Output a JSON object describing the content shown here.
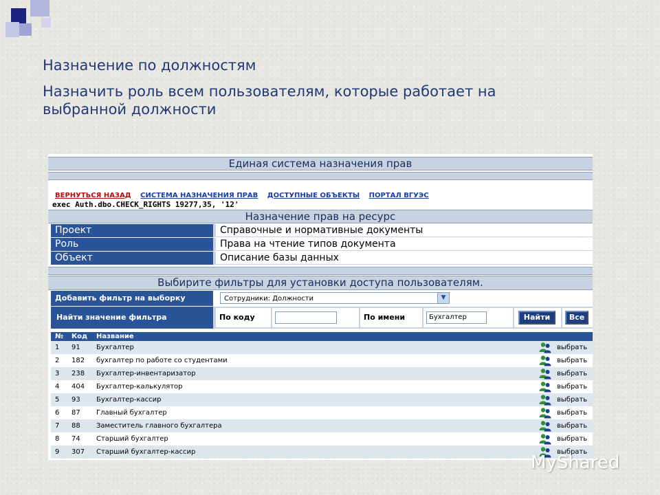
{
  "slide": {
    "title": "Назначение по должностям",
    "subtitle": "Назначить роль всем пользователям, которые работает на выбранной должности",
    "logo_text": "MyShared"
  },
  "app": {
    "header_title": "Единая система назначения прав",
    "nav_links": [
      "ВЕРНУТЬСЯ НАЗАД",
      "СИСТЕМА НАЗНАЧЕНИЯ ПРАВ",
      "ДОСТУПНЫЕ ОБЪЕКТЫ",
      "ПОРТАЛ ВГУЭС"
    ],
    "exec_line": "exec Auth.dbo.CHECK_RIGHTS 19277,35, '12'",
    "resource_title": "Назначение прав на ресурс",
    "resource_rows": [
      {
        "label": "Проект",
        "value": "Справочные и нормативные документы"
      },
      {
        "label": "Роль",
        "value": "Права на чтение типов документа"
      },
      {
        "label": "Объект",
        "value": "Описание базы данных"
      }
    ],
    "filter_title": "Выбирите фильтры для установки доступа пользователям.",
    "add_filter_label": "Добавить фильтр на выборку",
    "filter_select_value": "Сотрудники: Должности",
    "find_label": "Найти значение фильтра",
    "by_code_label": "По коду",
    "by_code_value": "",
    "by_name_label": "По имени",
    "by_name_value": "Бухгалтер",
    "find_button": "Найти",
    "all_button": "Все",
    "table": {
      "headers": [
        "№",
        "Код",
        "Название"
      ],
      "pick_label": "выбрать",
      "rows": [
        {
          "num": "1",
          "code": "91",
          "name": "Бухгалтер"
        },
        {
          "num": "2",
          "code": "182",
          "name": "бухгалтер по работе со студентами"
        },
        {
          "num": "3",
          "code": "238",
          "name": "Бухгалтер-инвентаризатор"
        },
        {
          "num": "4",
          "code": "404",
          "name": "Бухгалтер-калькулятор"
        },
        {
          "num": "5",
          "code": "93",
          "name": "Бухгалтер-кассир"
        },
        {
          "num": "6",
          "code": "87",
          "name": "Главный бухгалтер"
        },
        {
          "num": "7",
          "code": "88",
          "name": "Заместитель главного бухгалтера"
        },
        {
          "num": "8",
          "code": "74",
          "name": "Старший бухгалтер"
        },
        {
          "num": "9",
          "code": "307",
          "name": "Старший бухгалтер-кассир"
        }
      ]
    }
  },
  "colors": {
    "header_bar": "#c7d3e2",
    "label_blue": "#2a5498",
    "title_text": "#1f3a78"
  }
}
